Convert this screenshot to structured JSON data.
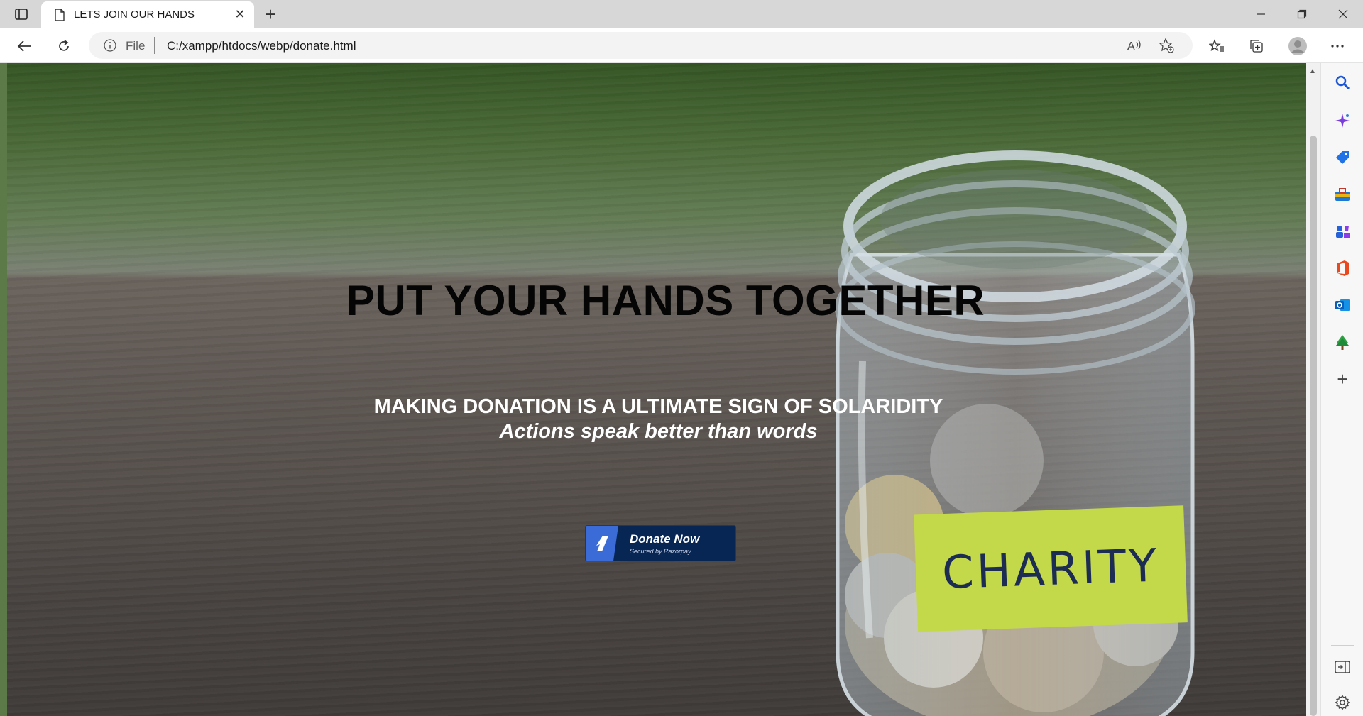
{
  "browser": {
    "tab_title": "LETS JOIN OUR HANDS",
    "scheme_label": "File",
    "url": "C:/xampp/htdocs/webp/donate.html"
  },
  "page": {
    "heading": "PUT YOUR HANDS TOGETHER",
    "subheading": "MAKING DONATION IS A ULTIMATE SIGN OF SOLARIDITY",
    "tagline": "Actions speak better than words",
    "jar_label": "CHARITY",
    "donate_button": {
      "label": "Donate Now",
      "secured_text": "Secured by Razorpay"
    }
  },
  "colors": {
    "donate_bg": "#072654",
    "donate_logo": "#3a6bd6",
    "jar_label_bg": "#c4d94a"
  },
  "sidebar_icons": [
    "search-icon",
    "copilot-icon",
    "shopping-icon",
    "tools-icon",
    "games-icon",
    "office-icon",
    "outlook-icon",
    "tree-icon",
    "add-icon",
    "hide-sidebar-icon",
    "settings-icon"
  ]
}
